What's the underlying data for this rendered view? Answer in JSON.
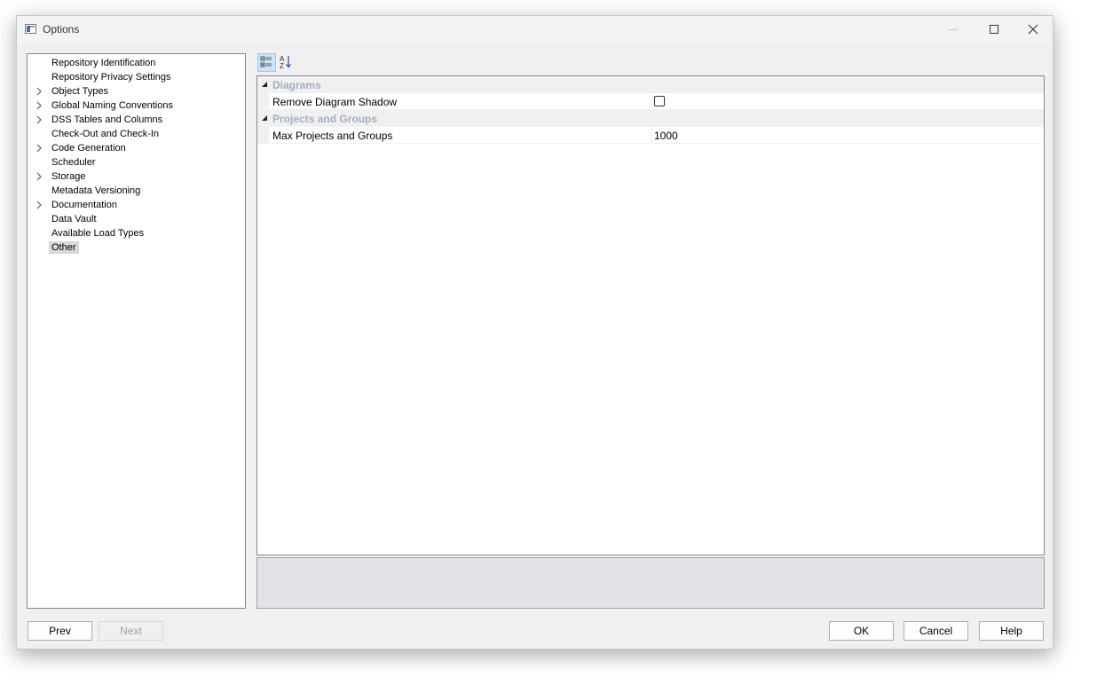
{
  "window": {
    "title": "Options"
  },
  "tree": {
    "items": [
      {
        "label": "Repository Identification",
        "expandable": false,
        "selected": false
      },
      {
        "label": "Repository Privacy Settings",
        "expandable": false,
        "selected": false
      },
      {
        "label": "Object Types",
        "expandable": true,
        "selected": false
      },
      {
        "label": "Global Naming Conventions",
        "expandable": true,
        "selected": false
      },
      {
        "label": "DSS Tables and Columns",
        "expandable": true,
        "selected": false
      },
      {
        "label": "Check-Out and Check-In",
        "expandable": false,
        "selected": false
      },
      {
        "label": "Code Generation",
        "expandable": true,
        "selected": false
      },
      {
        "label": "Scheduler",
        "expandable": false,
        "selected": false
      },
      {
        "label": "Storage",
        "expandable": true,
        "selected": false
      },
      {
        "label": "Metadata Versioning",
        "expandable": false,
        "selected": false
      },
      {
        "label": "Documentation",
        "expandable": true,
        "selected": false
      },
      {
        "label": "Data Vault",
        "expandable": false,
        "selected": false
      },
      {
        "label": "Available Load Types",
        "expandable": false,
        "selected": false
      },
      {
        "label": "Other",
        "expandable": false,
        "selected": true
      }
    ]
  },
  "toolbar": {
    "categorized_icon": "categorized-view-icon",
    "alphabetical_icon": "sort-alphabetical-icon"
  },
  "property_grid": {
    "categories": [
      {
        "label": "Diagrams",
        "properties": [
          {
            "name": "Remove Diagram Shadow",
            "type": "checkbox",
            "checked": false
          }
        ]
      },
      {
        "label": "Projects and Groups",
        "properties": [
          {
            "name": "Max Projects and Groups",
            "type": "text",
            "value": "1000"
          }
        ]
      }
    ]
  },
  "buttons": {
    "prev": "Prev",
    "next": "Next",
    "ok": "OK",
    "cancel": "Cancel",
    "help": "Help"
  },
  "colors": {
    "category_text": "#a3afbd",
    "selection": "#d9d9d9",
    "toolbar_active": "#cce4f7",
    "description_pane": "#e1e3e9"
  }
}
